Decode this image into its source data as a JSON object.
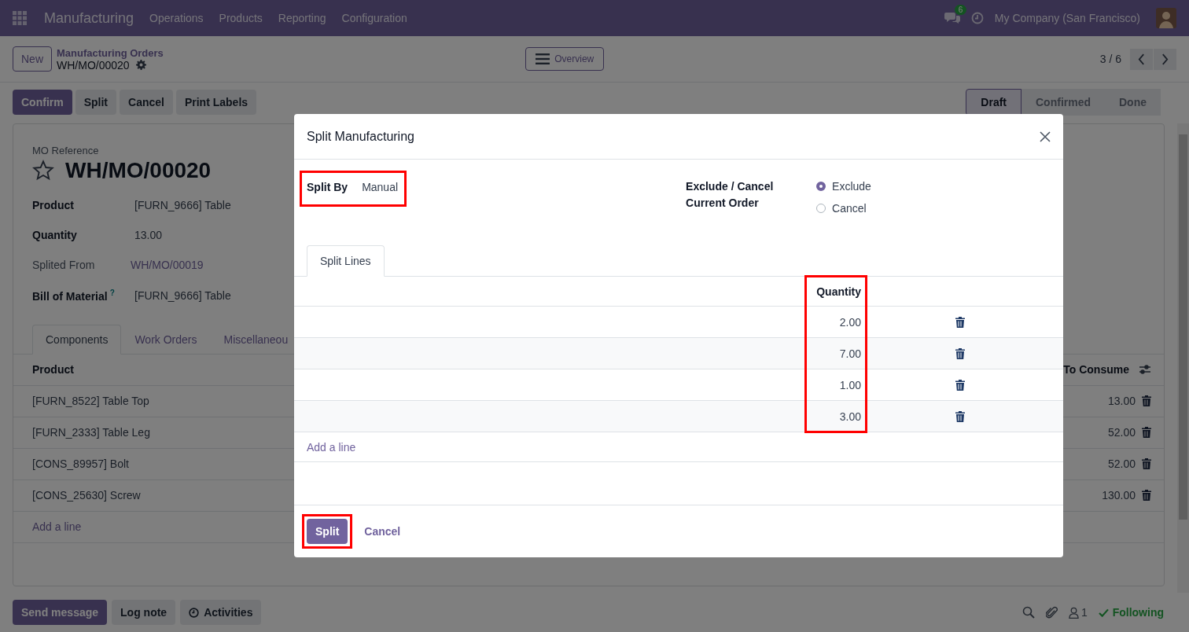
{
  "navbar": {
    "app_name": "Manufacturing",
    "menu": [
      "Operations",
      "Products",
      "Reporting",
      "Configuration"
    ],
    "messages_count": "6",
    "company": "My Company (San Francisco)"
  },
  "control_panel": {
    "new_button": "New",
    "breadcrumb": "Manufacturing Orders",
    "record": "WH/MO/00020",
    "overview_button": "Overview",
    "pager": "3 / 6"
  },
  "actions": [
    {
      "label": "Confirm",
      "kind": "primary"
    },
    {
      "label": "Split",
      "kind": "secondary"
    },
    {
      "label": "Cancel",
      "kind": "secondary"
    },
    {
      "label": "Print Labels",
      "kind": "secondary"
    }
  ],
  "status_steps": [
    {
      "label": "Draft",
      "selected": true
    },
    {
      "label": "Confirmed",
      "selected": false
    },
    {
      "label": "Done",
      "selected": false
    }
  ],
  "form": {
    "reference_label": "MO Reference",
    "title": "WH/MO/00020",
    "starred": false,
    "fields": [
      {
        "label": "Product",
        "value": "[FURN_9666] Table",
        "kind": "plain"
      },
      {
        "label": "Quantity",
        "value": "13.00",
        "kind": "plain"
      },
      {
        "label": "Splited From",
        "value": "WH/MO/00019",
        "kind": "link"
      },
      {
        "label": "Bill of Material",
        "help": "?",
        "value": "[FURN_9666] Table",
        "kind": "plain"
      }
    ],
    "tabs": [
      {
        "label": "Components",
        "selected": true
      },
      {
        "label": "Work Orders",
        "selected": false
      },
      {
        "label": "Miscellaneou",
        "selected": false
      }
    ],
    "table": {
      "columns": [
        "Product",
        "To Consume"
      ],
      "rows": [
        {
          "product": "[FURN_8522] Table Top",
          "to_consume": "13.00"
        },
        {
          "product": "[FURN_2333] Table Leg",
          "to_consume": "52.00"
        },
        {
          "product": "[CONS_89957] Bolt",
          "to_consume": "52.00"
        },
        {
          "product": "[CONS_25630] Screw",
          "to_consume": "130.00"
        }
      ],
      "add_line": "Add a line"
    }
  },
  "chatter": {
    "buttons": [
      {
        "label": "Send message",
        "kind": "primary"
      },
      {
        "label": "Log note",
        "kind": "secondary"
      },
      {
        "label": "Activities",
        "kind": "activities"
      }
    ],
    "followers_count": "1",
    "following": "Following"
  },
  "dialog": {
    "title": "Split Manufacturing",
    "split_by_label": "Split By",
    "split_by_value": "Manual",
    "exclude_label": "Exclude / Cancel Current Order",
    "options": [
      {
        "label": "Exclude",
        "selected": true
      },
      {
        "label": "Cancel",
        "selected": false
      }
    ],
    "tabs": [
      {
        "label": "Split Lines",
        "selected": true
      }
    ],
    "columns": [
      "Quantity"
    ],
    "lines": [
      {
        "quantity": "2.00"
      },
      {
        "quantity": "7.00"
      },
      {
        "quantity": "1.00"
      },
      {
        "quantity": "3.00"
      }
    ],
    "add_line": "Add a line",
    "buttons": [
      {
        "label": "Split",
        "kind": "primary"
      },
      {
        "label": "Cancel",
        "kind": "link"
      }
    ]
  }
}
